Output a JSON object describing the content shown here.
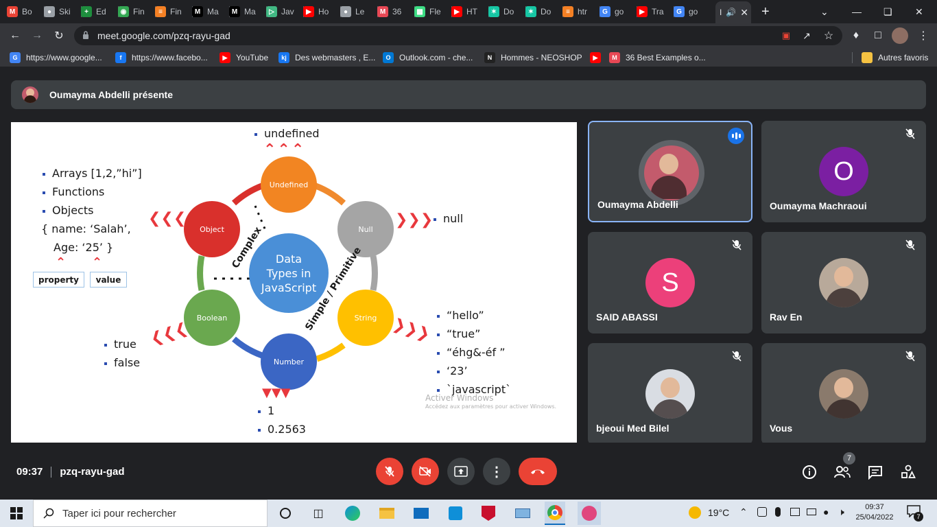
{
  "browser": {
    "tabs": [
      {
        "label": "Bo",
        "icon": "gmail-icon",
        "color": "#ea4335"
      },
      {
        "label": "Ski",
        "icon": "globe-icon",
        "color": "#9aa0a6"
      },
      {
        "label": "Ed",
        "icon": "plus-icon",
        "color": "#1e8e3e"
      },
      {
        "label": "Fin",
        "icon": "eye-icon",
        "color": "#34a853"
      },
      {
        "label": "Fin",
        "icon": "stack-icon",
        "color": "#f48024"
      },
      {
        "label": "Ma",
        "icon": "medium-icon",
        "color": "#000000"
      },
      {
        "label": "Ma",
        "icon": "medium-icon",
        "color": "#000000"
      },
      {
        "label": "Jav",
        "icon": "code-icon",
        "color": "#41b883"
      },
      {
        "label": "Ho",
        "icon": "youtube-icon",
        "color": "#ff0000"
      },
      {
        "label": "Le",
        "icon": "globe-icon",
        "color": "#9aa0a6"
      },
      {
        "label": "36",
        "icon": "mail-icon",
        "color": "#e84855"
      },
      {
        "label": "Fle",
        "icon": "android-icon",
        "color": "#3ddc84"
      },
      {
        "label": "HT",
        "icon": "youtube-icon",
        "color": "#ff0000"
      },
      {
        "label": "Do",
        "icon": "star-icon",
        "color": "#16c6a4"
      },
      {
        "label": "Do",
        "icon": "star-icon",
        "color": "#16c6a4"
      },
      {
        "label": "htr",
        "icon": "stack-icon",
        "color": "#f48024"
      },
      {
        "label": "go",
        "icon": "google-icon",
        "color": "#4285f4"
      },
      {
        "label": "Tra",
        "icon": "youtube-icon",
        "color": "#ff0000"
      },
      {
        "label": "go",
        "icon": "google-icon",
        "color": "#4285f4"
      }
    ],
    "active_tab": {
      "label": "I",
      "icon": "meet-icon"
    },
    "url": "meet.google.com/pzq-rayu-gad",
    "bookmarks": [
      {
        "label": "https://www.google...",
        "icon": "google-icon",
        "color": "#4285f4"
      },
      {
        "label": "https://www.facebo...",
        "icon": "facebook-icon",
        "color": "#1877f2"
      },
      {
        "label": "YouTube",
        "icon": "youtube-icon",
        "color": "#ff0000"
      },
      {
        "label": "Des webmasters , E...",
        "icon": "kj-icon",
        "color": "#1877f2"
      },
      {
        "label": "Outlook.com - che...",
        "icon": "outlook-icon",
        "color": "#0078d4"
      },
      {
        "label": "Hommes - NEOSHOP",
        "icon": "neoshop-icon",
        "color": "#222222"
      },
      {
        "label": "",
        "icon": "youtube-icon",
        "color": "#ff0000"
      },
      {
        "label": "36 Best Examples o...",
        "icon": "mail-icon",
        "color": "#e84855"
      }
    ],
    "other_bookmarks": "Autres favoris"
  },
  "meet": {
    "presenter_label": "Oumayma Abdelli présente",
    "meeting_time": "09:37",
    "meeting_code": "pzq-rayu-gad",
    "participant_count": "7",
    "participants": [
      {
        "name": "Oumayma Abdelli",
        "speaking": true,
        "avatar": "photo",
        "photo_bg": "#c35b6c"
      },
      {
        "name": "Oumayma Machraoui",
        "initial": "O",
        "avatar_color": "#7b1fa2"
      },
      {
        "name": "SAID ABASSI",
        "initial": "S",
        "avatar_color": "#ec407a"
      },
      {
        "name": "Rav En",
        "avatar": "photo",
        "photo_bg": "#b8a99a"
      },
      {
        "name": "bjeoui Med Bilel",
        "avatar": "photo",
        "photo_bg": "#d9dde3"
      },
      {
        "name": "Vous",
        "avatar": "photo",
        "photo_bg": "#8a7a6c"
      }
    ]
  },
  "slide": {
    "center": [
      "Data",
      "Types in",
      "JavaScript"
    ],
    "nodes": {
      "undefined": "Undefined",
      "null": "Null",
      "string": "String",
      "number": "Number",
      "boolean": "Boolean",
      "object": "Object"
    },
    "complex_label": "Complex",
    "primitive_label": "Simple / Primitive",
    "undefined_examples": [
      "undefined"
    ],
    "null_examples": [
      "null"
    ],
    "string_examples": [
      "“hello”",
      "“true”",
      "“éhg&-éf ”",
      "‘23’",
      "`javascript`"
    ],
    "number_examples": [
      "1",
      "0.2563"
    ],
    "boolean_examples": [
      "true",
      "false"
    ],
    "object_examples": [
      "Arrays [1,2,”hi”]",
      "Functions",
      "Objects"
    ],
    "object_literal_1": "{  name: ‘Salah’,",
    "object_literal_2": "Age: ‘25’  }",
    "property_label": "property",
    "value_label": "value",
    "watermark_title": "Activer Windows",
    "watermark_text": "Accédez aux paramètres pour activer Windows."
  },
  "taskbar": {
    "search_placeholder": "Taper ici pour rechercher",
    "weather": "19°C",
    "time": "09:37",
    "date": "25/04/2022",
    "notification_count": "7"
  }
}
